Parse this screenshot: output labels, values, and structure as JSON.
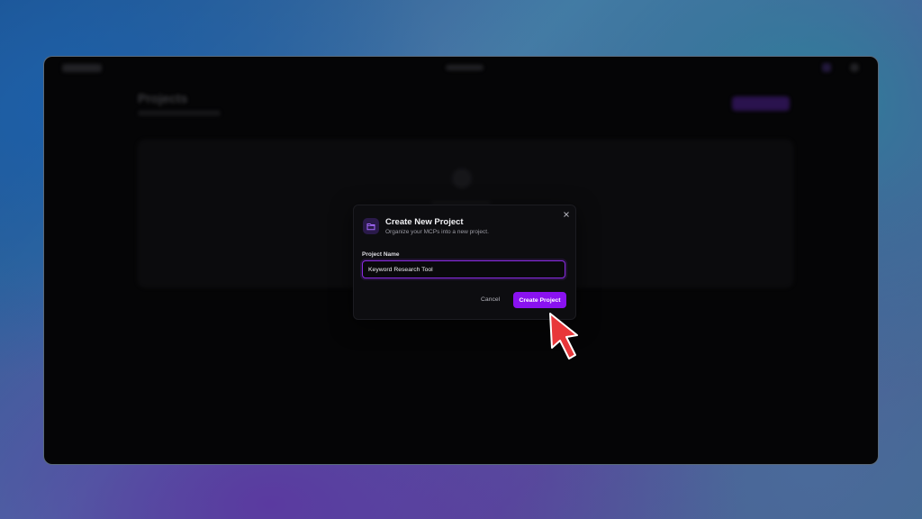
{
  "dialog": {
    "title": "Create New Project",
    "subtitle": "Organize your MCPs into a new project.",
    "field_label": "Project Name",
    "input_value": "Keyword Research Tool",
    "cancel_label": "Cancel",
    "create_label": "Create Project"
  },
  "background_page": {
    "title": "Projects"
  },
  "icons": {
    "dialog_icon": "folder-icon",
    "close": "close-icon",
    "pointer": "arrow-pointer-icon"
  },
  "colors": {
    "accent": "#8a12f0",
    "input_border": "#8a2be2",
    "cursor": "#e8373a"
  }
}
